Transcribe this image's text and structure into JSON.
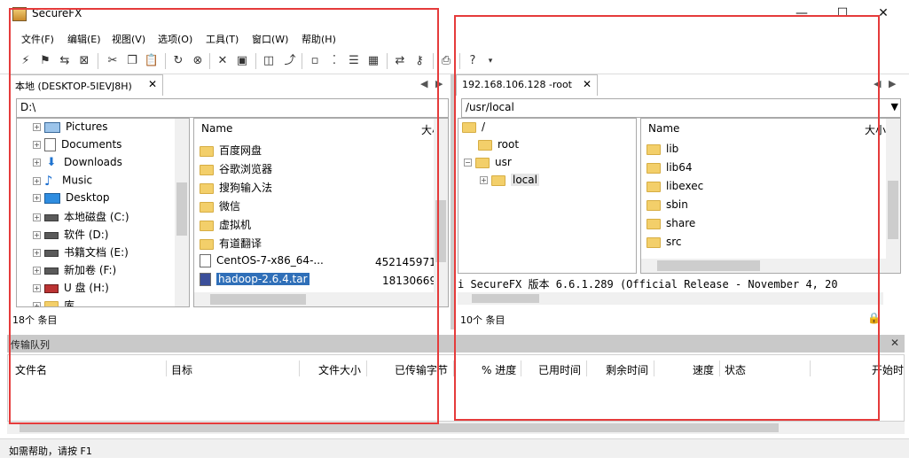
{
  "window": {
    "title": "SecureFX",
    "minimize": "—",
    "maximize": "☐",
    "close": "✕"
  },
  "menu": [
    "文件(F)",
    "编辑(E)",
    "视图(V)",
    "选项(O)",
    "工具(T)",
    "窗口(W)",
    "帮助(H)"
  ],
  "left_pane": {
    "tab_label": "本地 (DESKTOP-5IEVJ8H)",
    "tab_close": "✕",
    "path": "D:\\",
    "tree": [
      {
        "label": "Pictures",
        "icon": "pictures-icon"
      },
      {
        "label": "Documents",
        "icon": "documents-icon"
      },
      {
        "label": "Downloads",
        "icon": "downloads-icon"
      },
      {
        "label": "Music",
        "icon": "music-icon"
      },
      {
        "label": "Desktop",
        "icon": "desktop-icon"
      },
      {
        "label": "本地磁盘 (C:)",
        "icon": "drive-icon"
      },
      {
        "label": "软件 (D:)",
        "icon": "drive-icon"
      },
      {
        "label": "书籍文档 (E:)",
        "icon": "drive-icon"
      },
      {
        "label": "新加卷 (F:)",
        "icon": "drive-icon"
      },
      {
        "label": "U 盘 (H:)",
        "icon": "usb-drive-icon"
      },
      {
        "label": "库",
        "icon": "folder-icon"
      }
    ],
    "list_header": {
      "name": "Name",
      "size": "大小"
    },
    "files": [
      {
        "name": "百度网盘",
        "size": "",
        "type": "folder"
      },
      {
        "name": "谷歌浏览器",
        "size": "",
        "type": "folder"
      },
      {
        "name": "搜狗输入法",
        "size": "",
        "type": "folder"
      },
      {
        "name": "微信",
        "size": "",
        "type": "folder"
      },
      {
        "name": "虚拟机",
        "size": "",
        "type": "folder"
      },
      {
        "name": "有道翻译",
        "size": "",
        "type": "folder"
      },
      {
        "name": "CentOS-7-x86_64-...",
        "size": "452145971",
        "type": "file"
      },
      {
        "name": "hadoop-2.6.4.tar",
        "size": "18130669",
        "type": "archive"
      }
    ],
    "status": "18个 条目"
  },
  "right_pane": {
    "tab_label": "192.168.106.128 -root",
    "tab_close": "✕",
    "path": "/usr/local",
    "tree": [
      {
        "label": "/"
      },
      {
        "label": "root"
      },
      {
        "label": "usr"
      },
      {
        "label": "local"
      }
    ],
    "list_header": {
      "name": "Name",
      "size": "大小"
    },
    "files": [
      {
        "name": "lib"
      },
      {
        "name": "lib64"
      },
      {
        "name": "libexec"
      },
      {
        "name": "sbin"
      },
      {
        "name": "share"
      },
      {
        "name": "src"
      }
    ],
    "log_text": "i SecureFX 版本 6.6.1.289 (Official Release - November 4, 20",
    "status": "10个 条目"
  },
  "queue": {
    "title": "传输队列",
    "close": "✕",
    "columns": [
      "文件名",
      "目标",
      "文件大小",
      "已传输字节",
      "% 进度",
      "已用时间",
      "剩余时间",
      "速度",
      "状态",
      "开始时"
    ]
  },
  "statusbar": {
    "text": "如需帮助，请按 F1"
  },
  "nav": {
    "prev": "◀",
    "next": "▶",
    "dropdown": "▼",
    "lock": "🔒"
  },
  "colors": {
    "highlight_box": "#e53b3b",
    "selection": "#2f6fb8",
    "folder": "#f3cf6a"
  }
}
